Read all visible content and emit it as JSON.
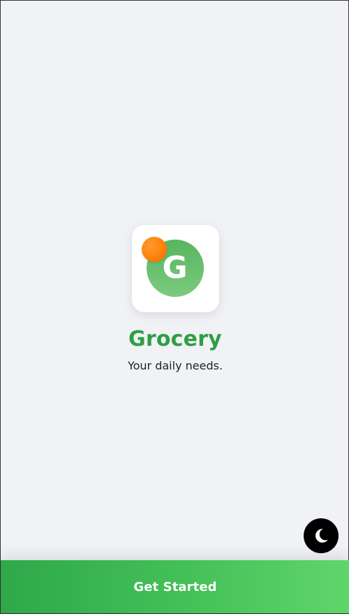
{
  "app": {
    "name": "Grocery",
    "tagline": "Your daily needs.",
    "logo_letter": "G"
  },
  "actions": {
    "get_started_label": "Get Started"
  },
  "icons": {
    "theme_toggle": "moon-icon",
    "logo_badge": "orange-dot-icon"
  },
  "colors": {
    "page_background": "#f0f2f5",
    "brand_green": "#2f9e44",
    "logo_green": "#66bb6a",
    "accent_orange": "#ff7a00",
    "button_gradient_start": "#2ea84a",
    "button_gradient_end": "#5fd66b",
    "toggle_background": "#000000"
  }
}
